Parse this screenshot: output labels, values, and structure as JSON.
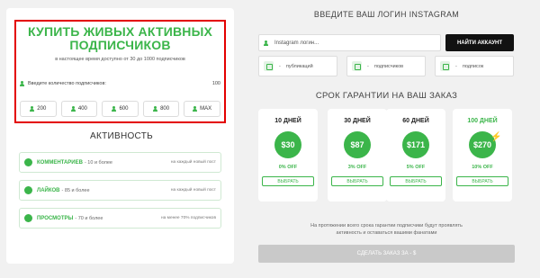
{
  "buy": {
    "title_line1": "КУПИТЬ ЖИВЫХ АКТИВНЫХ",
    "title_line2": "ПОДПИСЧИКОВ",
    "subtitle": "в настоящее время доступно от 30 до 1000 подписчиков",
    "qty_label": "Введите количество подписчиков:",
    "qty_value": "100",
    "buttons": [
      "200",
      "400",
      "600",
      "800",
      "MAX"
    ]
  },
  "activity": {
    "title": "АКТИВНОСТЬ",
    "items": [
      {
        "name": "КОММЕНТАРИЕВ",
        "desc": "- 10 и более",
        "note": "на каждый новый пост"
      },
      {
        "name": "ЛАЙКОВ",
        "desc": "- 85 и более",
        "note": "на каждый новый пост"
      },
      {
        "name": "ПРОСМОТРЫ",
        "desc": "- 70 и более",
        "note": "на менее 70% подписчиков"
      }
    ]
  },
  "login": {
    "title": "ВВЕДИТЕ ВАШ ЛОГИН INSTAGRAM",
    "placeholder": "Instagram логин...",
    "button": "НАЙТИ АККАУНТ"
  },
  "stats": [
    {
      "value": "-",
      "label": "публикаций"
    },
    {
      "value": "-",
      "label": "подписчиков"
    },
    {
      "value": "-",
      "label": "подписок"
    }
  ],
  "guarantee": {
    "title": "СРОК ГАРАНТИИ НА ВАШ ЗАКАЗ",
    "plans": [
      {
        "name": "10 ДНЕЙ",
        "price": "$30",
        "off": "0% OFF",
        "select": "ВЫБРАТЬ"
      },
      {
        "name": "30 ДНЕЙ",
        "price": "$87",
        "off": "3% OFF",
        "select": "ВЫБРАТЬ"
      },
      {
        "name": "60 ДНЕЙ",
        "price": "$171",
        "off": "5% OFF",
        "select": "ВЫБРАТЬ"
      },
      {
        "name": "100 ДНЕЙ",
        "price": "$270",
        "off": "10% OFF",
        "select": "ВЫБРАТЬ"
      }
    ],
    "note_line1": "На протяжении всего срока гарантии подписчики будут проявлять",
    "note_line2": "активность и оставаться вашими фанатами"
  },
  "order_button": "СДЕЛАТЬ ЗАКАЗ ЗА - $",
  "colors": {
    "accent": "#3bb54a",
    "highlight_border": "#e30000",
    "dark_button": "#111111",
    "disabled_button": "#c9c9c9"
  }
}
